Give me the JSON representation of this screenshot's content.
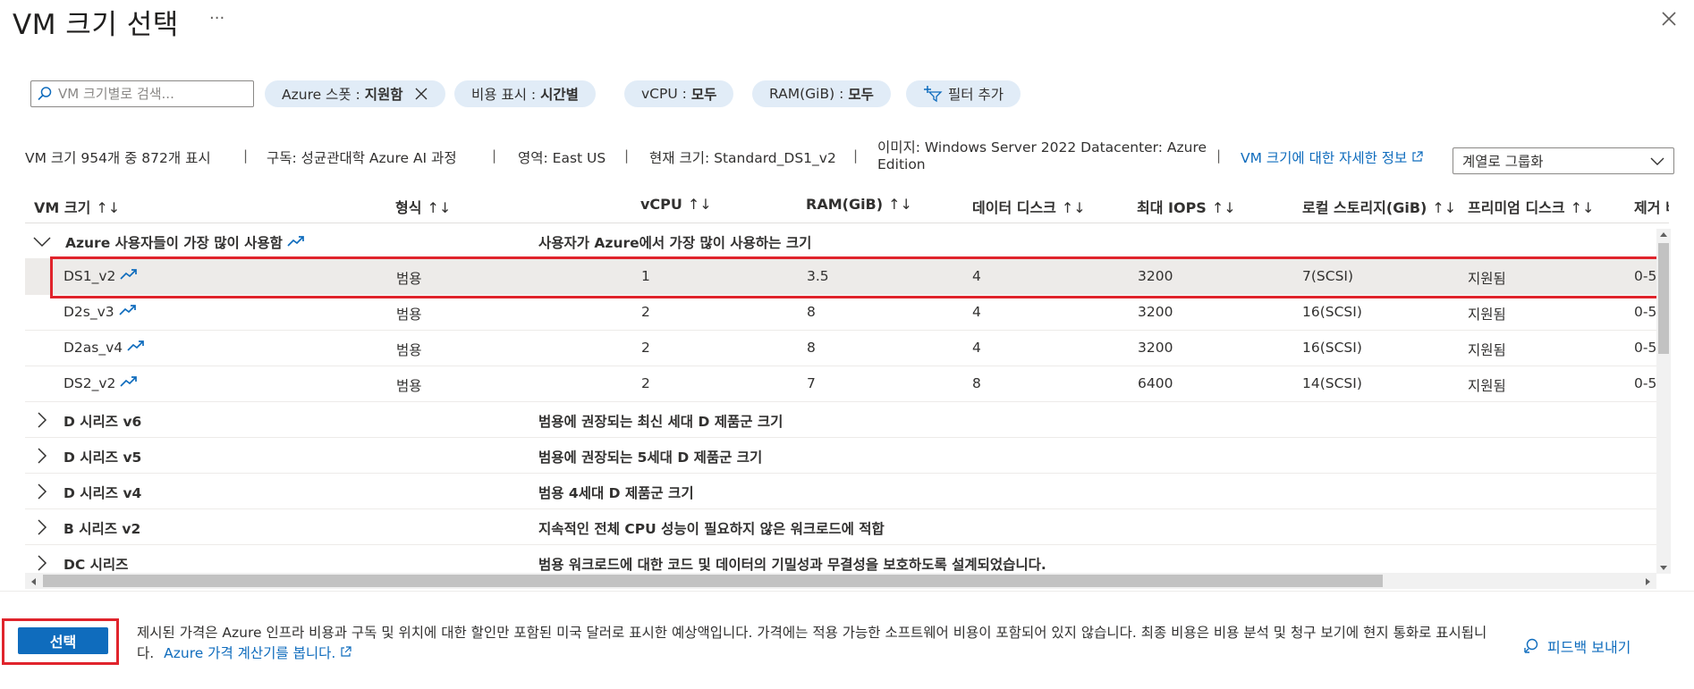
{
  "dialog": {
    "title": "VM 크기 선택",
    "more": "···"
  },
  "filters": {
    "search_placeholder": "VM 크기별로 검색...",
    "pills": [
      {
        "label": "Azure 스폿 :",
        "value": "지원함"
      },
      {
        "label": "비용 표시 :",
        "value": "시간별"
      },
      {
        "label": "vCPU :",
        "value": "모두"
      },
      {
        "label": "RAM(GiB) :",
        "value": "모두"
      }
    ],
    "add_filter": "필터 추가"
  },
  "info": {
    "count": "VM 크기 954개 중 872개 표시",
    "subscription": "구독: 성균관대학 Azure AI 과정",
    "region": "영역: East US",
    "current_size": "현재 크기: Standard_DS1_v2",
    "image_line1": "이미지: Windows Server 2022 Datacenter: Azure",
    "image_line2": "Edition",
    "details_link": "VM 크기에 대한 자세한 정보",
    "group_by": "계열로 그룹화"
  },
  "table": {
    "columns": [
      "VM 크기",
      "형식",
      "vCPU",
      "RAM(GiB)",
      "데이터 디스크",
      "최대 IOPS",
      "로컬 스토리지(GiB)",
      "프리미엄 디스크",
      "제거 비"
    ],
    "sort_glyph": "↑↓",
    "top_group": {
      "name": "Azure 사용자들이 가장 많이 사용함",
      "description": "사용자가 Azure에서 가장 많이 사용하는 크기"
    },
    "rows": [
      {
        "size": "DS1_v2",
        "type": "범용",
        "vcpu": "1",
        "ram": "3.5",
        "disks": "4",
        "iops": "3200",
        "storage": "7(SCSI)",
        "premium": "지원됨",
        "extra": "0-5"
      },
      {
        "size": "D2s_v3",
        "type": "범용",
        "vcpu": "2",
        "ram": "8",
        "disks": "4",
        "iops": "3200",
        "storage": "16(SCSI)",
        "premium": "지원됨",
        "extra": "0-5"
      },
      {
        "size": "D2as_v4",
        "type": "범용",
        "vcpu": "2",
        "ram": "8",
        "disks": "4",
        "iops": "3200",
        "storage": "16(SCSI)",
        "premium": "지원됨",
        "extra": "0-5"
      },
      {
        "size": "DS2_v2",
        "type": "범용",
        "vcpu": "2",
        "ram": "7",
        "disks": "8",
        "iops": "6400",
        "storage": "14(SCSI)",
        "premium": "지원됨",
        "extra": "0-5"
      }
    ],
    "groups": [
      {
        "name": "D 시리즈 v6",
        "description": "범용에 권장되는 최신 세대 D 제품군 크기"
      },
      {
        "name": "D 시리즈 v5",
        "description": "범용에 권장되는 5세대 D 제품군 크기"
      },
      {
        "name": "D 시리즈 v4",
        "description": "범용 4세대 D 제품군 크기"
      },
      {
        "name": "B 시리즈 v2",
        "description": "지속적인 전체 CPU 성능이 필요하지 않은 워크로드에 적합"
      },
      {
        "name": "DC 시리즈",
        "description": "범용 워크로드에 대한 코드 및 데이터의 기밀성과 무결성을 보호하도록 설계되었습니다."
      }
    ]
  },
  "footer": {
    "select_label": "선택",
    "note": "제시된 가격은 Azure 인프라 비용과 구독 및 위치에 대한 할인만 포함된 미국 달러로 표시한 예상액입니다. 가격에는 적용 가능한 소프트웨어 비용이 포함되어 있지 않습니다. 최종 비용은 비용 분석 및 청구 보기에 현지 통화로 표시됩니다.",
    "calc_link": "Azure 가격 계산기를 봅니다.",
    "feedback": "피드백 보내기"
  },
  "colors": {
    "accent": "#0f6cbd",
    "pill_bg": "#e1ecf7",
    "highlight_red": "#e0242c",
    "selected_row": "#edebe9"
  }
}
